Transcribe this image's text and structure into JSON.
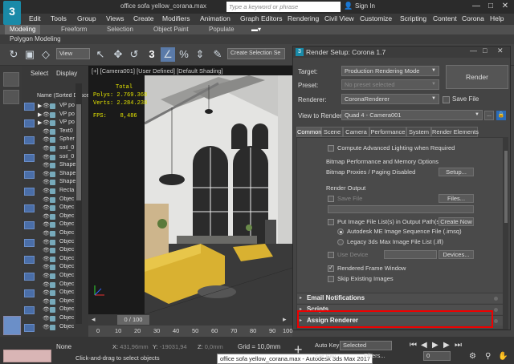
{
  "title": {
    "app_logo": "3",
    "file_title": "office sofa yellow_corana.max",
    "search_placeholder": "Type a keyword or phrase",
    "sign_in": "Sign In",
    "min": "—",
    "max": "□",
    "close": "✕"
  },
  "menu": [
    "Edit",
    "Tools",
    "Group",
    "Views",
    "Create",
    "Modifiers",
    "Animation",
    "Graph Editors",
    "Rendering",
    "Civil View",
    "Customize",
    "Scripting",
    "Content",
    "Corona",
    "Help"
  ],
  "ribbon": {
    "tabs": [
      "Modeling",
      "Freeform",
      "Selection",
      "Object Paint",
      "Populate"
    ],
    "sub_label": "Polygon Modeling"
  },
  "toolbar": {
    "view_dropdown": "View",
    "selection_set": "Create Selection Se"
  },
  "explorer": {
    "tabs": [
      "Select",
      "Display"
    ],
    "header": "Name (Sorted Desce",
    "rows": [
      "VP po",
      "VP po",
      "VP po",
      "Text0",
      "Spher",
      "soil_0",
      "soil_0",
      "Shape",
      "Shape",
      "Shape",
      "Recta",
      "Objec",
      "Objec",
      "Objec",
      "Objec",
      "Objec",
      "Objec",
      "Objec",
      "Objec",
      "Objec",
      "Objec",
      "Objec",
      "Objec",
      "Objec",
      "Objec",
      "Objec",
      "Objec"
    ]
  },
  "viewport": {
    "label": "[+] [Camera001] [User Defined] [Default Shading]",
    "stats_total": "Total",
    "polys_label": "Polys:",
    "polys_value": "2.769.368",
    "verts_label": "Verts:",
    "verts_value": "2.284.238",
    "fps_label": "FPS:",
    "fps_value": "8,486"
  },
  "timeline": {
    "slider": "0 / 100",
    "ticks": [
      "0",
      "10",
      "20",
      "30",
      "40",
      "50",
      "60",
      "70",
      "80",
      "90",
      "100"
    ]
  },
  "status": {
    "selection": "None",
    "hint": "Click-and-drag to select objects",
    "x_label": "X:",
    "x_value": "431,96mm",
    "y_label": "Y:",
    "y_value": "-19031,94",
    "z_label": "Z:",
    "z_value": "0,0mm",
    "grid": "Grid = 10,0mm",
    "taskbar_tip": "office sofa yellow_corana.max - Autodesk 3ds Max 2017",
    "auto_key": "Auto Key",
    "set_key": "Set Key",
    "selected": "Selected",
    "filters": "Filters...",
    "frame": "0"
  },
  "render_setup": {
    "title": "Render Setup: Corona 1.7",
    "target_label": "Target:",
    "target_value": "Production Rendering Mode",
    "preset_label": "Preset:",
    "preset_value": "No preset selected",
    "renderer_label": "Renderer:",
    "renderer_value": "CoronaRenderer",
    "save_file": "Save File",
    "view_label": "View to Render:",
    "view_value": "Quad 4 - Camera001",
    "render_button": "Render",
    "tabs": [
      "Common",
      "Scene",
      "Camera",
      "Performance",
      "System",
      "Render Elements"
    ],
    "panel": {
      "compute_adv": "Compute Advanced Lighting when Required",
      "bitmap_perf": "Bitmap Performance and Memory Options",
      "bitmap_proxies": "Bitmap Proxies / Paging Disabled",
      "setup_btn": "Setup...",
      "render_output": "Render Output",
      "save_file": "Save File",
      "files_btn": "Files...",
      "put_image": "Put Image File List(s) in Output Path(s)",
      "create_now": "Create Now",
      "autodesk_me": "Autodesk ME Image Sequence File (.imsq)",
      "legacy": "Legacy 3ds Max Image File List (.ifl)",
      "use_device": "Use Device",
      "devices_btn": "Devices...",
      "rendered_frame": "Rendered Frame Window",
      "skip_existing": "Skip Existing Images"
    },
    "rollouts": [
      "Email Notifications",
      "Scripts",
      "Assign Renderer"
    ]
  }
}
